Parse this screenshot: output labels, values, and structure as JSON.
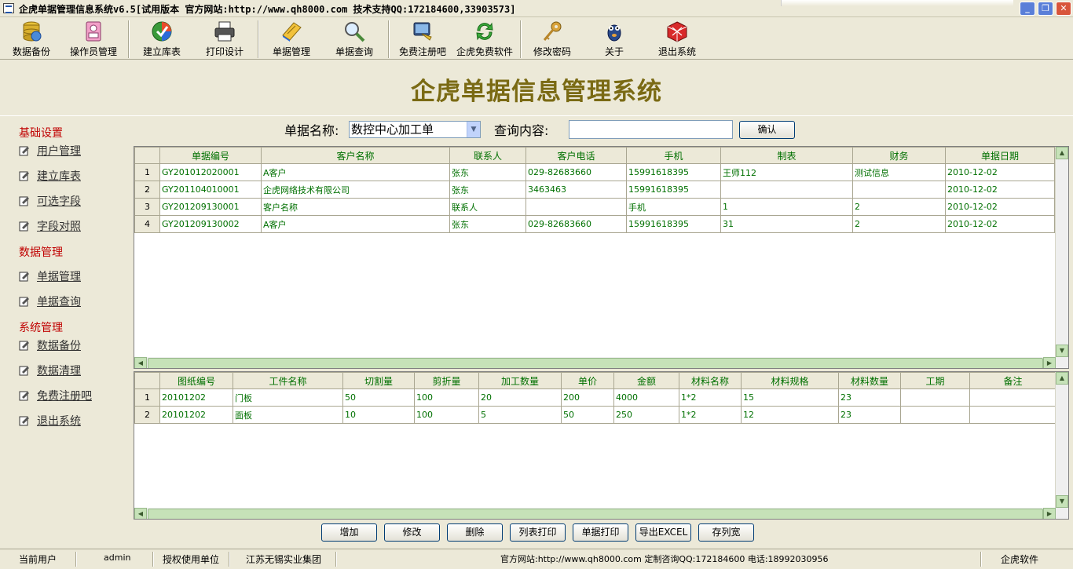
{
  "window": {
    "title": "企虎单据管理信息系统v6.5[试用版本 官方网站:http://www.qh8000.com 技术支持QQ:172184600,33903573]"
  },
  "toolbar": [
    {
      "label": "数据备份",
      "icon": "database-backup-icon"
    },
    {
      "label": "操作员管理",
      "icon": "operator-icon"
    },
    {
      "label": "建立库表",
      "icon": "create-table-icon"
    },
    {
      "label": "打印设计",
      "icon": "printer-icon"
    },
    {
      "label": "单据管理",
      "icon": "document-manage-icon"
    },
    {
      "label": "单据查询",
      "icon": "magnifier-icon"
    },
    {
      "label": "免费注册吧",
      "icon": "register-icon"
    },
    {
      "label": "企虎免费软件",
      "icon": "refresh-icon"
    },
    {
      "label": "修改密码",
      "icon": "key-icon"
    },
    {
      "label": "关于",
      "icon": "about-icon"
    },
    {
      "label": "退出系统",
      "icon": "exit-icon"
    }
  ],
  "header": {
    "title": "企虎单据信息管理系统"
  },
  "sidebar": {
    "groups": [
      {
        "title": "基础设置",
        "items": [
          "用户管理",
          "建立库表",
          "可选字段",
          "字段对照"
        ]
      },
      {
        "title": "数据管理",
        "items": [
          "单据管理",
          "单据查询"
        ]
      },
      {
        "title": "系统管理",
        "items": [
          "数据备份",
          "数据清理",
          "免费注册吧",
          "退出系统"
        ]
      }
    ]
  },
  "search": {
    "doc_name_label": "单据名称:",
    "doc_name_value": "数控中心加工单",
    "query_label": "查询内容:",
    "query_value": "",
    "confirm_label": "确认"
  },
  "master_grid": {
    "columns": [
      "单据编号",
      "客户名称",
      "联系人",
      "客户电话",
      "手机",
      "制表",
      "财务",
      "单据日期"
    ],
    "rows": [
      {
        "n": "1",
        "cells": [
          "GY201012020001",
          "A客户",
          "张东",
          "029-82683660",
          "15991618395",
          "王师112",
          "测试信息",
          "2010-12-02"
        ]
      },
      {
        "n": "2",
        "cells": [
          "GY201104010001",
          "企虎网络技术有限公司",
          "张东",
          "3463463",
          "15991618395",
          "",
          "",
          "2010-12-02"
        ]
      },
      {
        "n": "3",
        "cells": [
          "GY201209130001",
          "客户名称",
          "联系人",
          "",
          "手机",
          "1",
          "2",
          "2010-12-02"
        ]
      },
      {
        "n": "4",
        "cells": [
          "GY201209130002",
          "A客户",
          "张东",
          "029-82683660",
          "15991618395",
          "31",
          "2",
          "2010-12-02"
        ]
      }
    ]
  },
  "detail_grid": {
    "columns": [
      "图纸编号",
      "工件名称",
      "切割量",
      "剪折量",
      "加工数量",
      "单价",
      "金额",
      "材料名称",
      "材料规格",
      "材料数量",
      "工期",
      "备注"
    ],
    "rows": [
      {
        "n": "1",
        "cells": [
          "20101202",
          "门板",
          "50",
          "100",
          "20",
          "200",
          "4000",
          "1*2",
          "15",
          "23",
          "",
          ""
        ]
      },
      {
        "n": "2",
        "cells": [
          "20101202",
          "面板",
          "10",
          "100",
          "5",
          "50",
          "250",
          "1*2",
          "12",
          "23",
          "",
          ""
        ]
      }
    ]
  },
  "actions": [
    "增加",
    "修改",
    "删除",
    "列表打印",
    "单据打印",
    "导出EXCEL",
    "存列宽"
  ],
  "statusbar": {
    "current_user_label": "当前用户",
    "current_user": "admin",
    "licensed_label": "授权使用单位",
    "licensed_unit": "江苏无锡实业集团",
    "contact": "官方网站:http://www.qh8000.com 定制咨询QQ:172184600 电话:18992030956",
    "brand": "企虎软件"
  },
  "colors": {
    "title_accent": "#7A6A14",
    "group_red": "#C00000",
    "grid_text": "#007000"
  }
}
